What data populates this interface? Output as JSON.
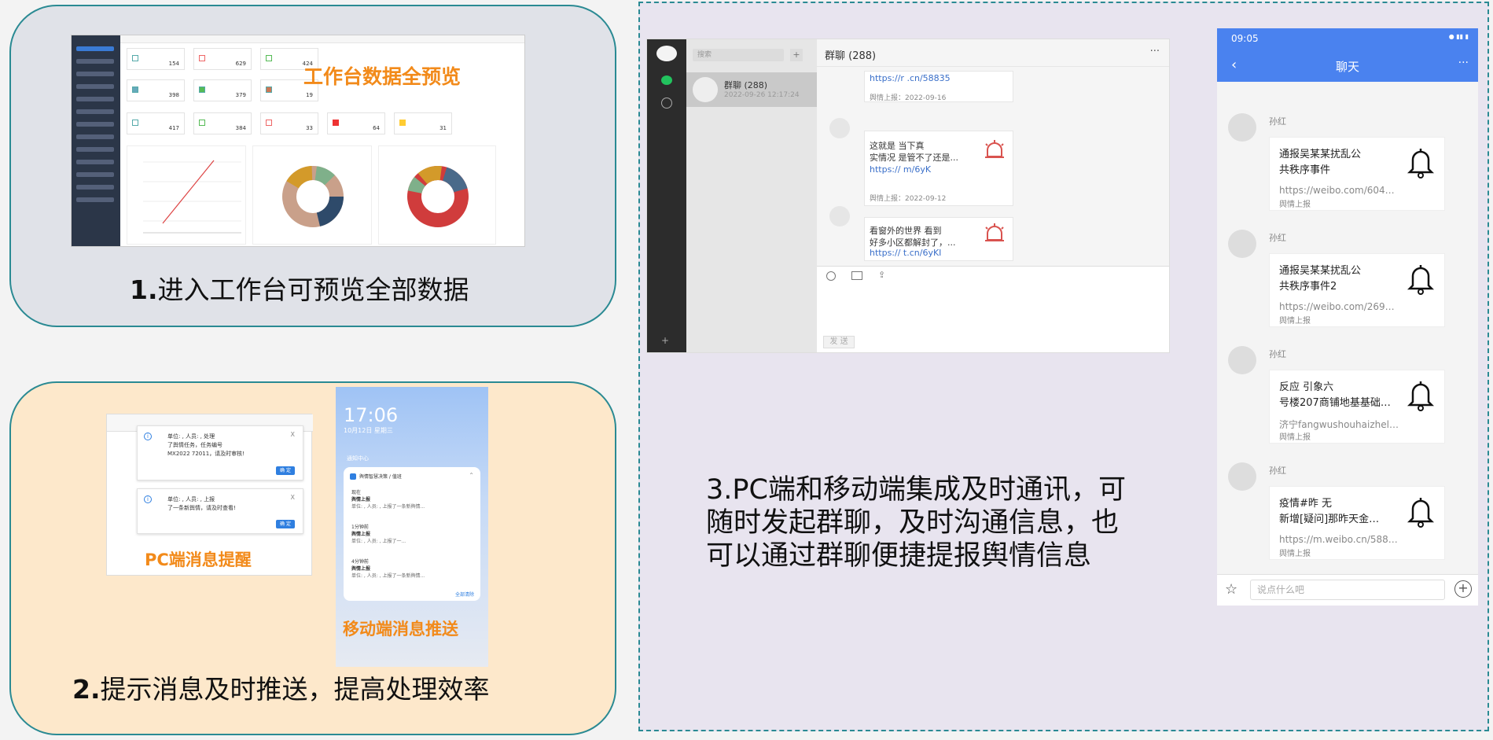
{
  "card1": {
    "caption_num": "1.",
    "caption_text": "进入工作台可预览全部数据",
    "overlay": "工作台数据全预览",
    "stats_row1": [
      "154",
      "629",
      "424"
    ],
    "stats_row2": [
      "398",
      "379",
      "19"
    ],
    "stats_row3": [
      "417",
      "384",
      "33",
      "64",
      "31"
    ]
  },
  "card2": {
    "caption_num": "2.",
    "caption_text": "提示消息及时推送，提高处理效率",
    "pc_label": "PC端消息提醒",
    "mobile_label": "移动端消息推送",
    "pc_notifications": [
      {
        "line1": "单位:          , 人员:          , 处理",
        "line2": "了舆情任务，任务编号",
        "line3": "MX2022          72011，请及时审核!",
        "button": "确 定",
        "close": "X"
      },
      {
        "line1": "单位:          , 人员:          , 上报",
        "line2": "了一条新舆情，请及时查看!",
        "line3": "",
        "button": "确 定",
        "close": "X"
      }
    ],
    "mobile": {
      "time": "17:06",
      "date": "10月12日 星期三",
      "center": "通知中心",
      "app_name": "舆情智慧决策 / 值班",
      "items": [
        {
          "when": "现在",
          "title": "舆情上报",
          "body": "单位:          , 人员:          , 上报了一条新舆情..."
        },
        {
          "when": "1分钟前",
          "title": "舆情上报",
          "body": "单位:          , 人员:          , 上报了一..."
        },
        {
          "when": "4分钟前",
          "title": "舆情上报",
          "body": "单位:          , 人员:          , 上报了一条新舆情..."
        }
      ],
      "clear": "全部清除"
    }
  },
  "panel3": {
    "caption_lines": [
      "3.PC端和移动端集成及时通讯，可",
      "随时发起群聊，及时沟通信息，也",
      "可以通过群聊便捷提报舆情信息"
    ],
    "pc": {
      "search_placeholder": "搜索",
      "group_name": "群聊  (288)",
      "group_date": "2022-09-26 12:17:24",
      "title": "群聊  (288)",
      "more": "···",
      "messages": [
        {
          "link": "https://r          .cn/58835",
          "meta": "舆情上报：2022-09-16",
          "sender": "",
          "text1": "",
          "text2": ""
        },
        {
          "link": "https://          m/6yK",
          "meta": "舆情上报：2022-09-12",
          "sender": "",
          "text1": "这就是          当下真",
          "text2": "实情况 是管不了还是..."
        },
        {
          "link": "https://          t.cn/6yKI",
          "meta": "",
          "sender": "",
          "text1": "看窗外的世界 看到",
          "text2": "好多小区都解封了，..."
        }
      ],
      "send": "发 送"
    },
    "mobile": {
      "status_time": "09:05",
      "title": "聊天",
      "more": "···",
      "input_placeholder": "说点什么吧",
      "items": [
        {
          "name": "孙红",
          "t1": "          通报吴某某扰乱公",
          "t2": "共秩序事件",
          "link": "https://weibo.com/604…",
          "tag": "舆情上报"
        },
        {
          "name": "孙红",
          "t1": "          通报吴某某扰乱公",
          "t2": "共秩序事件2",
          "link": "https://weibo.com/269…",
          "tag": "舆情上报"
        },
        {
          "name": "孙红",
          "t1": "反应          引象六",
          "t2": "号楼207商铺地基基础…",
          "link": "济宁fangwushouhaizhel…",
          "tag": "舆情上报"
        },
        {
          "name": "孙红",
          "t1": "          疫情#昨          无",
          "t2": "新增[疑问]那昨天金…",
          "link": "https://m.weibo.cn/588…",
          "tag": "舆情上报"
        }
      ]
    }
  },
  "colors": {
    "accent": "#2a8a93",
    "orange": "#f28a1a",
    "blue": "#4a82ef"
  }
}
